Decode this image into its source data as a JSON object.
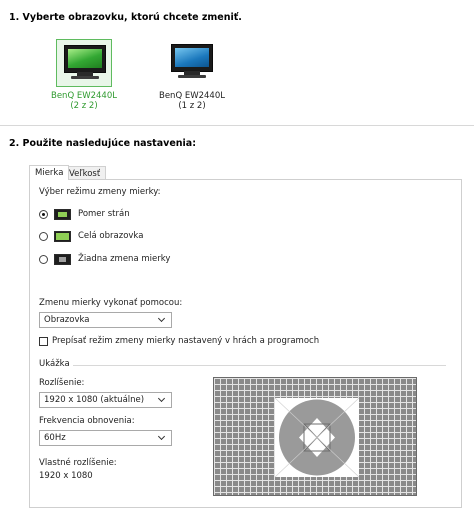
{
  "section1": {
    "title": "1. Vyberte obrazovku, ktorú chcete zmeniť.",
    "monitors": [
      {
        "name": "BenQ EW2440L",
        "sub": "(2 z 2)"
      },
      {
        "name": "BenQ EW2440L",
        "sub": "(1 z 2)"
      }
    ]
  },
  "section2": {
    "title": "2. Použite nasledujúce nastavenia:",
    "tabs": [
      "Mierka",
      "Veľkosť"
    ],
    "scaling_mode_label": "Výber režimu zmeny mierky:",
    "options": [
      "Pomer strán",
      "Celá obrazovka",
      "Žiadna zmena mierky"
    ],
    "perform_label": "Zmenu mierky vykonať pomocou:",
    "perform_value": "Obrazovka",
    "override_label": "Prepísať režim zmeny mierky nastavený v hrách a programoch",
    "preview_title": "Ukážka",
    "resolution_label": "Rozlíšenie:",
    "resolution_value": "1920 x 1080 (aktuálne)",
    "refresh_label": "Frekvencia obnovenia:",
    "refresh_value": "60Hz",
    "native_label": "Vlastné rozlíšenie:",
    "native_value": "1920 x 1080"
  },
  "colors": {
    "selected_monitor_border": "#5fbb5f",
    "selected_monitor_text": "#2e9a2e"
  }
}
